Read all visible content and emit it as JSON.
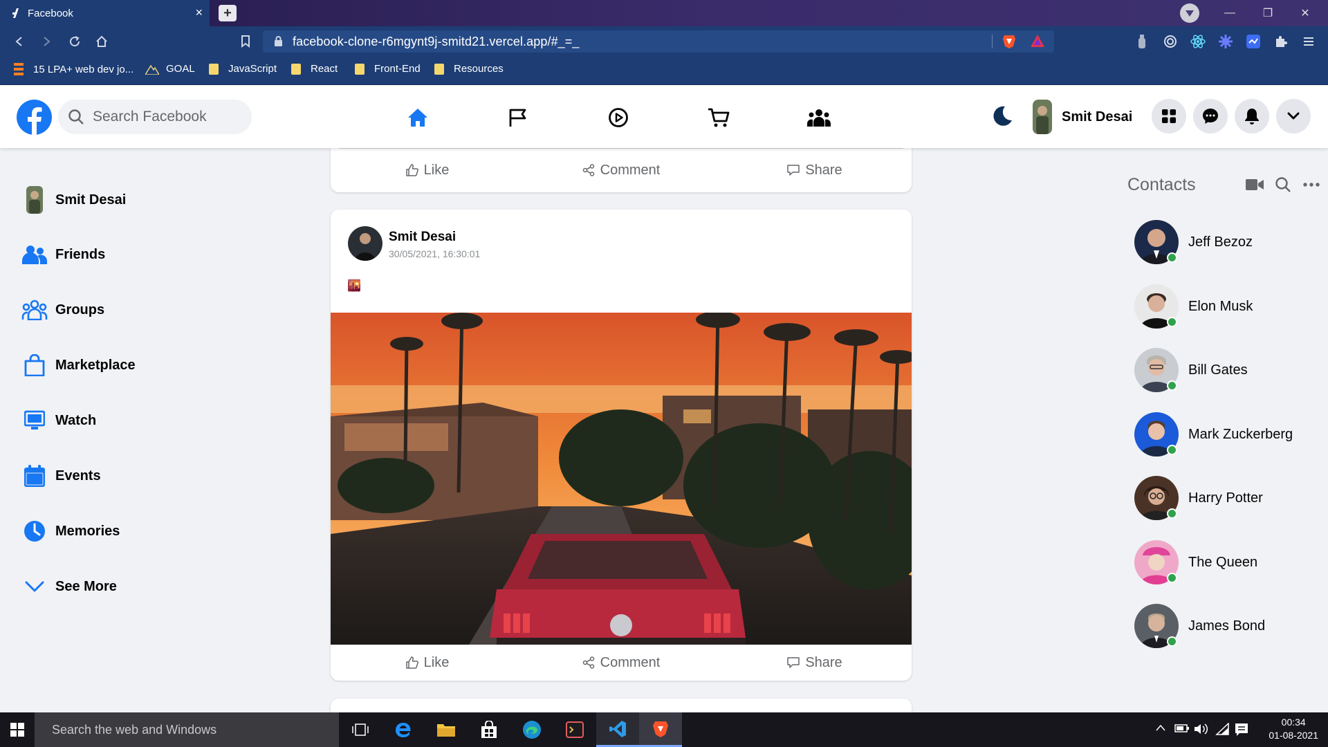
{
  "browser": {
    "tab_title": "Facebook",
    "tab_close": "×",
    "new_tab": "+",
    "url": "facebook-clone-r6mgynt9j-smitd21.vercel.app/#_=_",
    "bookmarks": [
      "15 LPA+ web dev jo...",
      "GOAL",
      "JavaScript",
      "React",
      "Front-End",
      "Resources"
    ],
    "window_controls": [
      "—",
      "❐",
      "✕"
    ]
  },
  "header": {
    "search_placeholder": "Search Facebook",
    "nav_icons": [
      "home-icon",
      "flag-icon",
      "watch-icon",
      "marketplace-icon",
      "groups-icon"
    ],
    "active_nav": "home",
    "user_name": "Smit Desai",
    "accent": "#1877f2"
  },
  "sidebar": {
    "items": [
      {
        "label": "Smit Desai",
        "icon": "avatar"
      },
      {
        "label": "Friends",
        "icon": "friends-icon"
      },
      {
        "label": "Groups",
        "icon": "groups-icon"
      },
      {
        "label": "Marketplace",
        "icon": "marketplace-icon"
      },
      {
        "label": "Watch",
        "icon": "watch-icon"
      },
      {
        "label": "Events",
        "icon": "events-icon"
      },
      {
        "label": "Memories",
        "icon": "memories-icon"
      },
      {
        "label": "See More",
        "icon": "chevron-down-icon"
      }
    ]
  },
  "feed": {
    "actions": {
      "like": "Like",
      "comment": "Comment",
      "share": "Share"
    },
    "post": {
      "author": "Smit Desai",
      "timestamp": "30/05/2021, 16:30:01",
      "text": "🌇"
    }
  },
  "contacts": {
    "title": "Contacts",
    "list": [
      {
        "name": "Jeff Bezoz"
      },
      {
        "name": "Elon Musk"
      },
      {
        "name": "Bill Gates"
      },
      {
        "name": "Mark Zuckerberg"
      },
      {
        "name": "Harry Potter"
      },
      {
        "name": "The Queen"
      },
      {
        "name": "James Bond"
      }
    ],
    "online_color": "#31a24c"
  },
  "taskbar": {
    "search_text": "Search the web and Windows",
    "time": "00:34",
    "date": "01-08-2021"
  }
}
